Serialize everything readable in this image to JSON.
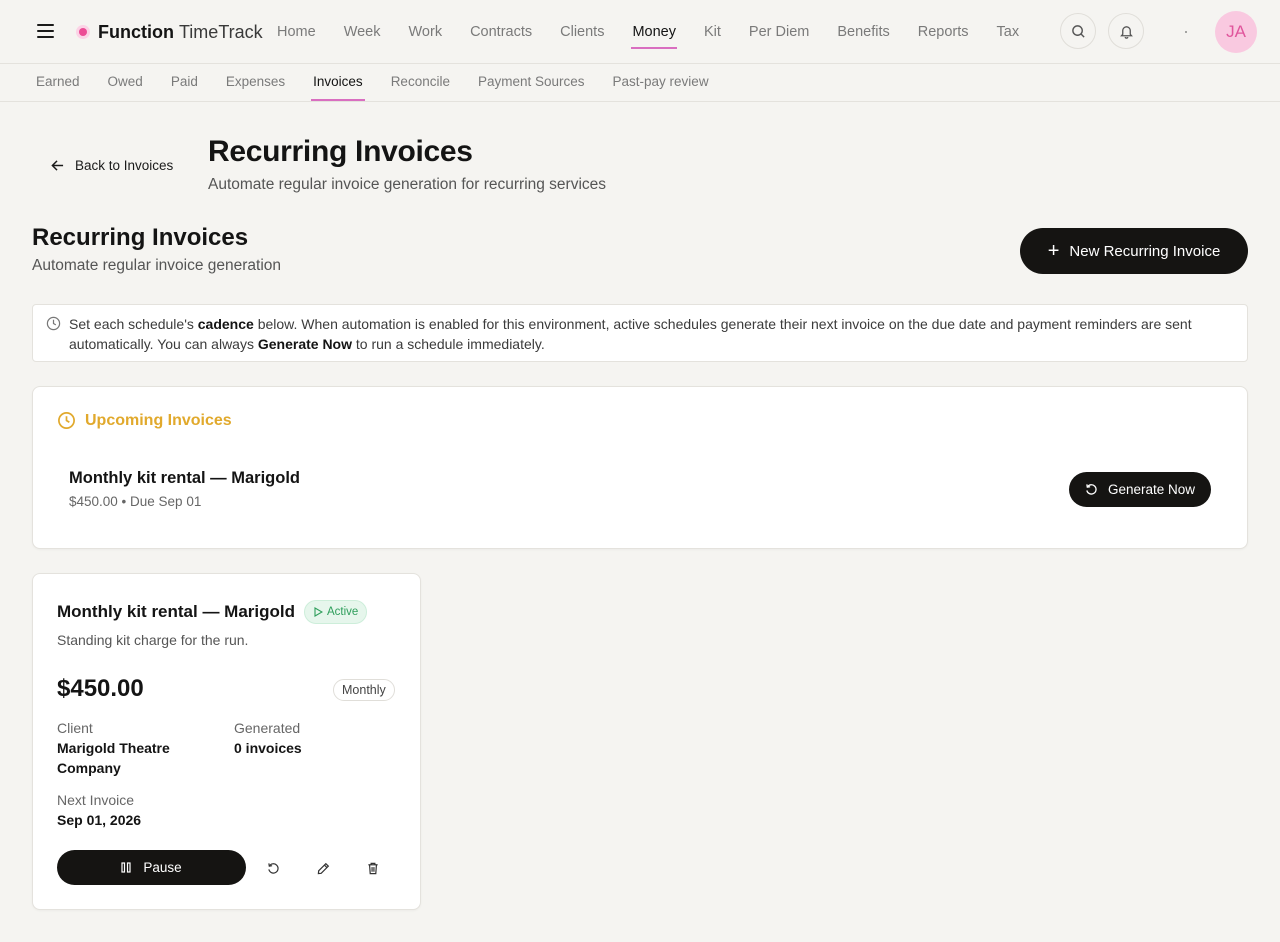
{
  "app": {
    "brand_bold": "Function",
    "brand_light": "TimeTrack",
    "avatar_initials": "JA",
    "accent": "#ec4c95"
  },
  "main_nav": [
    {
      "label": "Home"
    },
    {
      "label": "Week"
    },
    {
      "label": "Work"
    },
    {
      "label": "Contracts"
    },
    {
      "label": "Clients"
    },
    {
      "label": "Money"
    },
    {
      "label": "Kit"
    },
    {
      "label": "Per Diem"
    },
    {
      "label": "Benefits"
    },
    {
      "label": "Reports"
    },
    {
      "label": "Tax"
    }
  ],
  "main_nav_active": "Money",
  "sub_nav": [
    {
      "label": "Earned"
    },
    {
      "label": "Owed"
    },
    {
      "label": "Paid"
    },
    {
      "label": "Expenses"
    },
    {
      "label": "Invoices"
    },
    {
      "label": "Reconcile"
    },
    {
      "label": "Payment Sources"
    },
    {
      "label": "Past-pay review"
    }
  ],
  "sub_nav_active": "Invoices",
  "header": {
    "back_label": "Back to Invoices",
    "title": "Recurring Invoices",
    "subtitle": "Automate regular invoice generation for recurring services"
  },
  "section": {
    "title": "Recurring Invoices",
    "subtitle": "Automate regular invoice generation",
    "new_button": "New Recurring Invoice"
  },
  "info_banner": {
    "part1": "Set each schedule's ",
    "bold1": "cadence",
    "part2": " below. When automation is enabled for this environment, active schedules generate their next invoice on the due date and payment reminders are sent automatically. You can always ",
    "bold2": "Generate Now",
    "part3": " to run a schedule immediately."
  },
  "upcoming": {
    "heading": "Upcoming Invoices",
    "item_name": "Monthly kit rental — Marigold",
    "item_meta": "$450.00 • Due Sep 01",
    "generate_button": "Generate Now"
  },
  "schedule": {
    "title": "Monthly kit rental — Marigold",
    "status": "Active",
    "description": "Standing kit charge for the run.",
    "amount": "$450.00",
    "cadence": "Monthly",
    "client_label": "Client",
    "client_value": "Marigold Theatre Company",
    "generated_label": "Generated",
    "generated_value": "0 invoices",
    "next_label": "Next Invoice",
    "next_value": "Sep 01, 2026",
    "pause_button": "Pause"
  }
}
